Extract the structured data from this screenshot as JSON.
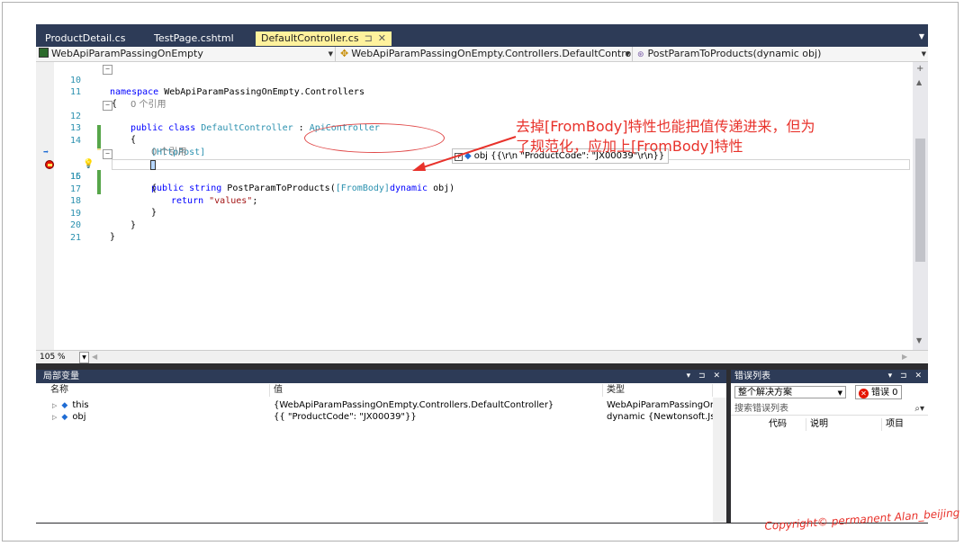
{
  "tabs": [
    {
      "label": "ProductDetail.cs",
      "active": false
    },
    {
      "label": "TestPage.cshtml",
      "active": false
    },
    {
      "label": "DefaultController.cs",
      "active": true
    }
  ],
  "tab_icons": {
    "pin": "pin-icon",
    "close": "close-icon"
  },
  "navbar": {
    "project": "WebApiParamPassingOnEmpty",
    "class": "WebApiParamPassingOnEmpty.Controllers.DefaultController",
    "member": "PostParamToProducts(dynamic obj)"
  },
  "code": {
    "line_numbers": [
      "10",
      "11",
      "",
      "12",
      "13",
      "14",
      "",
      "15",
      "16",
      "17",
      "18",
      "19",
      "20",
      "21"
    ],
    "l10_kw": "namespace",
    "l10_text": " WebApiParamPassingOnEmpty.Controllers",
    "l11": "{",
    "refs1": "0 个引用",
    "l12_kw": "public class",
    "l12_name": " DefaultController",
    "l12_sep": " : ",
    "l12_base": "ApiController",
    "l13": "{",
    "l14_attr": "[HttpPost]",
    "refs2": "0 个引用",
    "l15_kw": "public string",
    "l15_name": " PostParamToProducts(",
    "l15_attr": "[FromBody]",
    "l15_kw2": "dynamic",
    "l15_end": " obj)",
    "l16": "{",
    "l17_kw": "return",
    "l17_str": " \"values\"",
    "l17_end": ";",
    "l18": "}",
    "l19": "}",
    "l20": "}"
  },
  "datatip": {
    "name": "obj",
    "value": "{{\\r\\n  \"ProductCode\": \"JX00039\"\\r\\n}}"
  },
  "annotation": "去掉[FromBody]特性也能把值传递进来，但为\n了规范化，应加上[FromBody]特性",
  "zoom": "105 %",
  "locals": {
    "title": "局部变量",
    "columns": [
      "名称",
      "值",
      "类型"
    ],
    "rows": [
      {
        "name": "this",
        "value": "{WebApiParamPassingOnEmpty.Controllers.DefaultController}",
        "type": "WebApiParamPassingOnEm"
      },
      {
        "name": "obj",
        "value": "{{  \"ProductCode\": \"JX00039\"}}",
        "type": "dynamic {Newtonsoft.Json.L"
      }
    ]
  },
  "errors": {
    "title": "错误列表",
    "scope": "整个解决方案",
    "error_count_label": "错误 0",
    "search_placeholder": "搜索错误列表",
    "columns": [
      "代码",
      "说明",
      "项目"
    ]
  },
  "panel_controls": "▾ ⊐ ✕",
  "copyright": "Copyright© permanent  Alan_beijing",
  "colors": {
    "tab_bg": "#2d3b57",
    "active_tab": "#fff29d",
    "keyword": "#0000ff",
    "type": "#2b91af",
    "string": "#a31515",
    "annotation": "#e8322b"
  }
}
